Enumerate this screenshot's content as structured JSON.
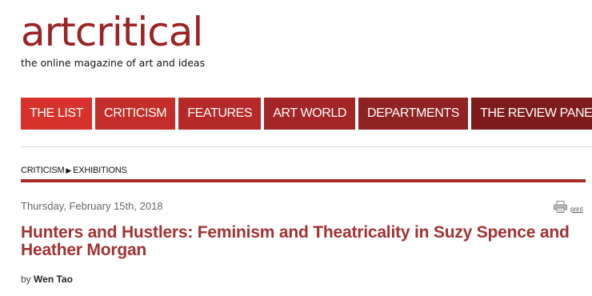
{
  "site": {
    "logo": "artcritical",
    "tagline": "the online magazine of art and ideas"
  },
  "nav": {
    "items": [
      {
        "label": "THE LIST",
        "color": "#d6322b"
      },
      {
        "label": "CRITICISM",
        "color": "#c42e2a"
      },
      {
        "label": "FEATURES",
        "color": "#b52a29"
      },
      {
        "label": "ART WORLD",
        "color": "#a32526"
      },
      {
        "label": "DEPARTMENTS",
        "color": "#8f2223"
      },
      {
        "label": "THE REVIEW PANEL",
        "color": "#7e1c1c"
      }
    ]
  },
  "breadcrumb": {
    "section": "CRITICISM",
    "separator": "▶",
    "subsection": "EXHIBITIONS"
  },
  "article": {
    "date": "Thursday, February 15th, 2018",
    "print_label": "print",
    "title": "Hunters and Hustlers: Feminism and Theatricality in Suzy Spence and Heather Morgan",
    "byline_prefix": "by",
    "author": "Wen Tao"
  },
  "colors": {
    "accent": "#a03232",
    "logo": "#9b2323"
  }
}
